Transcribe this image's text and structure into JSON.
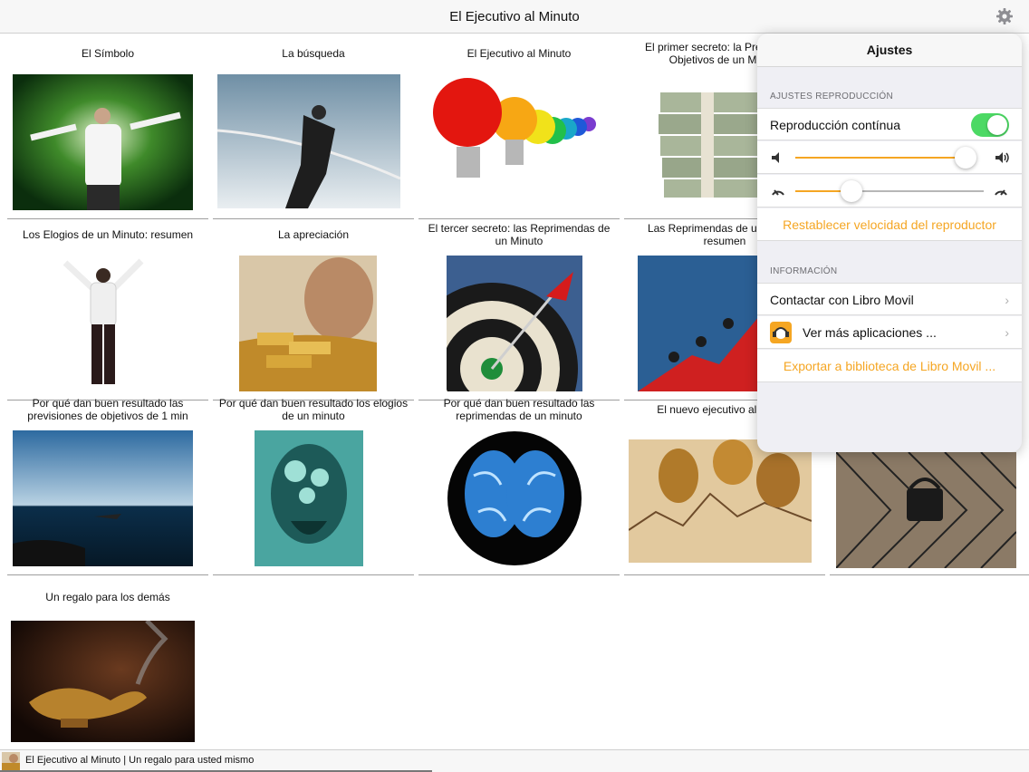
{
  "navbar": {
    "title": "El Ejecutivo al Minuto",
    "settings_icon": "gear-icon"
  },
  "colors": {
    "accent": "#f5a623",
    "toggle_on": "#4cd964"
  },
  "grid": {
    "items": [
      {
        "title": "El Símbolo",
        "thumb": "man-arms-outstretched-green-blur"
      },
      {
        "title": "La búsqueda",
        "thumb": "man-breaking-finish-tape"
      },
      {
        "title": "El Ejecutivo al Minuto",
        "thumb": "colored-light-bulbs"
      },
      {
        "title": "El primer secreto: la Previsión de Objetivos de un Minuto",
        "thumb": "stacks-of-dollar-bills"
      },
      {
        "title": "",
        "thumb": ""
      },
      {
        "title": "Los Elogios de un Minuto: resumen",
        "thumb": "man-arms-raised"
      },
      {
        "title": "La apreciación",
        "thumb": "child-with-gold-bars"
      },
      {
        "title": "El tercer secreto: las Reprimendas de un Minuto",
        "thumb": "dart-on-dartboard"
      },
      {
        "title": "Las Reprimendas de un Minuto: resumen",
        "thumb": "people-climbing-red-arrow"
      },
      {
        "title": "",
        "thumb": ""
      },
      {
        "title": "Por qué dan buen resultado las previsiones de objetivos de 1 min",
        "thumb": "sea-horizon"
      },
      {
        "title": "Por qué dan buen resultado los elogios de un minuto",
        "thumb": "head-with-gears"
      },
      {
        "title": "Por qué dan buen resultado las reprimendas de un minuto",
        "thumb": "blue-brain"
      },
      {
        "title": "El nuevo ejecutivo al minuto",
        "thumb": "coins-on-financial-chart"
      },
      {
        "title": "",
        "thumb": "padlock-on-chain-fence"
      },
      {
        "title": "Un regalo para los demás",
        "thumb": "magic-lamp"
      }
    ]
  },
  "footer": {
    "text": "El Ejecutivo al Minuto | Un regalo para usted mismo",
    "progress": 0.42
  },
  "settings": {
    "title": "Ajustes",
    "playback_section": "AJUSTES REPRODUCCIÓN",
    "continuous_label": "Reproducción contínua",
    "continuous_on": true,
    "volume": 0.95,
    "speed": 0.3,
    "reset_speed_label": "Restablecer velocidad del reproductor",
    "info_section": "INFORMACIÓN",
    "contact_label": "Contactar con Libro Movil",
    "more_apps_label": "Ver más aplicaciones ...",
    "export_label": "Exportar a biblioteca de Libro Movil ..."
  }
}
